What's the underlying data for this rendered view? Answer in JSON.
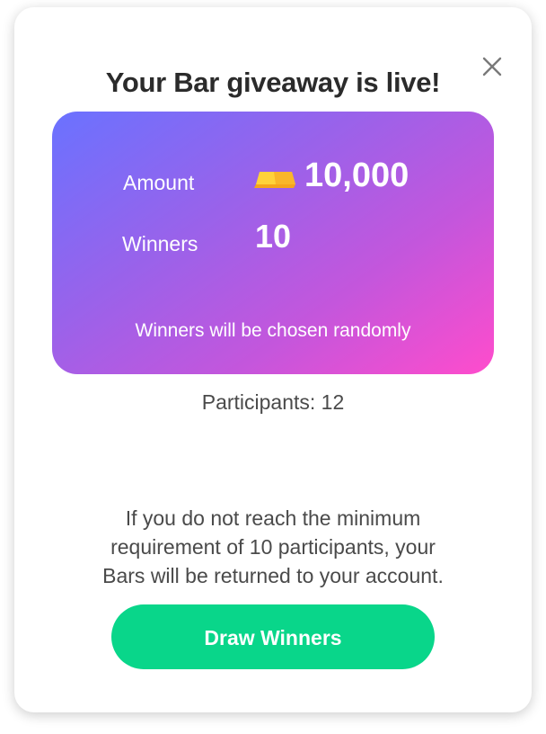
{
  "modal": {
    "title": "Your Bar giveaway is live!",
    "close_icon": "close-icon"
  },
  "card": {
    "amount_label": "Amount",
    "amount_value": "10,000",
    "amount_icon": "gold-bar-icon",
    "winners_label": "Winners",
    "winners_value": "10",
    "random_note": "Winners will be chosen randomly",
    "gradient_colors": [
      "#6a72ff",
      "#9a62ea",
      "#c456dc",
      "#ff4ccc"
    ]
  },
  "participants": {
    "text": "Participants: 12"
  },
  "requirement": {
    "line1": "If you do not reach the minimum",
    "line2": "requirement of 10 participants, your",
    "line3": "Bars will be returned to your account."
  },
  "actions": {
    "draw_label": "Draw Winners",
    "draw_color": "#09d68a"
  }
}
